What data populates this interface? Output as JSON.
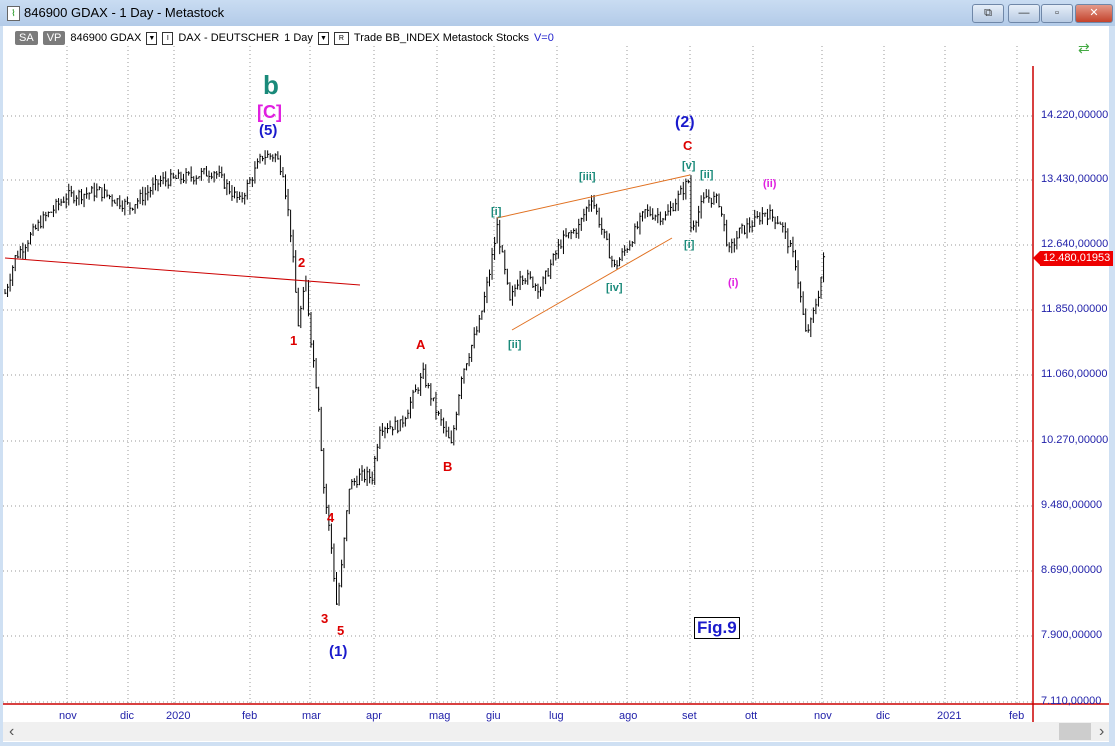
{
  "window": {
    "title": "846900 GDAX - 1 Day - Metastock",
    "buttons": [
      "⧉",
      "—",
      "▫",
      "✕"
    ]
  },
  "toolbar": {
    "sa": "SA",
    "vp": "VP",
    "symbol": "846900 GDAX",
    "name": "DAX - DEUTSCHER",
    "period": "1 Day",
    "r": "R",
    "items": "Trade  BB_INDEX  Metastock  Stocks",
    "v": "V=0",
    "i": "I"
  },
  "price_flag": "12.480,01953",
  "fig_label": "Fig.9",
  "chart_data": {
    "type": "ohlc",
    "y_ticks": [
      "14.220,00000",
      "13.430,00000",
      "12.640,00000",
      "11.850,00000",
      "11.060,00000",
      "10.270,00000",
      "9.480,00000",
      "8.690,00000",
      "7.900,00000",
      "7.110,00000"
    ],
    "ylim": [
      7110,
      14220
    ],
    "x_labels": [
      "nov",
      "dic",
      "2020",
      "feb",
      "mar",
      "apr",
      "mag",
      "giu",
      "lug",
      "ago",
      "set",
      "ott",
      "nov",
      "dic",
      "2021",
      "feb"
    ],
    "last_price": 12480.01953,
    "waypoints_day_price": [
      [
        0,
        12073
      ],
      [
        4,
        12505
      ],
      [
        14,
        12937
      ],
      [
        24,
        13245
      ],
      [
        37,
        13307
      ],
      [
        49,
        13122
      ],
      [
        61,
        13430
      ],
      [
        74,
        13492
      ],
      [
        82,
        13554
      ],
      [
        92,
        13183
      ],
      [
        101,
        13739
      ],
      [
        106,
        13739
      ],
      [
        109,
        13554
      ],
      [
        112,
        12813
      ],
      [
        115,
        11703
      ],
      [
        118,
        12196
      ],
      [
        120,
        11517
      ],
      [
        123,
        10715
      ],
      [
        125,
        9728
      ],
      [
        128,
        8988
      ],
      [
        130,
        8309
      ],
      [
        132,
        8741
      ],
      [
        135,
        9728
      ],
      [
        139,
        9851
      ],
      [
        144,
        9851
      ],
      [
        147,
        10468
      ],
      [
        155,
        10468
      ],
      [
        164,
        11085
      ],
      [
        169,
        10653
      ],
      [
        175,
        10221
      ],
      [
        179,
        11085
      ],
      [
        186,
        11703
      ],
      [
        190,
        12320
      ],
      [
        193,
        12875
      ],
      [
        198,
        11950
      ],
      [
        202,
        12320
      ],
      [
        210,
        12135
      ],
      [
        218,
        12690
      ],
      [
        225,
        12875
      ],
      [
        230,
        13245
      ],
      [
        235,
        12752
      ],
      [
        239,
        12382
      ],
      [
        245,
        12690
      ],
      [
        251,
        13060
      ],
      [
        259,
        12998
      ],
      [
        268,
        13430
      ],
      [
        269,
        12875
      ],
      [
        275,
        13245
      ],
      [
        280,
        13183
      ],
      [
        284,
        12566
      ],
      [
        288,
        12813
      ],
      [
        294,
        12937
      ],
      [
        298,
        13060
      ],
      [
        304,
        12937
      ],
      [
        310,
        12443
      ],
      [
        314,
        11579
      ],
      [
        316,
        11703
      ],
      [
        319,
        12073
      ],
      [
        321,
        12468
      ]
    ],
    "annotations": [
      "b",
      "[C]",
      "(5)",
      "1",
      "2",
      "3",
      "4",
      "5",
      "(1)",
      "A",
      "B",
      "[i]",
      "[ii]",
      "[iii]",
      "[iv]",
      "[v]",
      "[i]",
      "[ii]",
      "(2)",
      "C",
      "(i)",
      "(ii)"
    ]
  }
}
